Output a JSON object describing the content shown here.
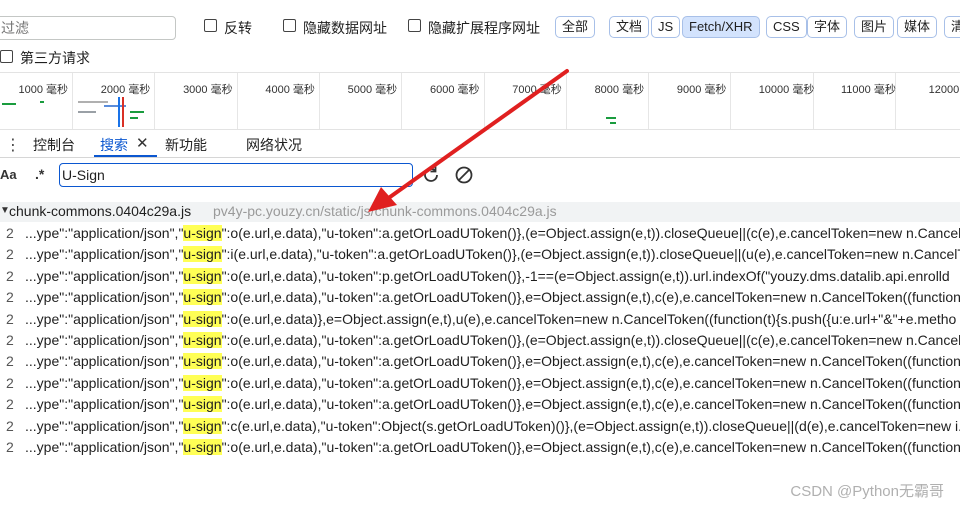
{
  "filter": {
    "placeholder": "过滤",
    "invert_label": "反转",
    "hide_data_urls_label": "隐藏数据网址",
    "hide_extension_urls_label": "隐藏扩展程序网址",
    "chips": [
      "全部",
      "文档",
      "JS",
      "Fetch/XHR",
      "CSS",
      "字体",
      "图片",
      "媒体",
      "清"
    ],
    "active_chip": "Fetch/XHR",
    "third_party_label": "第三方请求"
  },
  "timeline": {
    "ticks": [
      "1000 毫秒",
      "2000 毫秒",
      "3000 毫秒",
      "4000 毫秒",
      "5000 毫秒",
      "6000 毫秒",
      "7000 毫秒",
      "8000 毫秒",
      "9000 毫秒",
      "10000 毫秒",
      "11000 毫秒",
      "12000 毫"
    ]
  },
  "drawer": {
    "tabs": [
      "控制台",
      "搜索",
      "新功能",
      "网络状况"
    ],
    "active_tab": "搜索"
  },
  "search": {
    "case_label": "Aa",
    "regex_label": ".*",
    "query": "U-Sign"
  },
  "results": {
    "file_name": "chunk-commons.0404c29a.js",
    "file_path": "pv4y-pc.youzy.cn/static/js/chunk-commons.0404c29a.js",
    "rows": [
      {
        "line": "2",
        "pre": "...ype\":\"application/json\",\"",
        "match": "u-sign",
        "post": "\":o(e.url,e.data),\"u-token\":a.getOrLoadUToken()},(e=Object.assign(e,t)).closeQueue||(c(e),e.cancelToken=new n.CancelT"
      },
      {
        "line": "2",
        "pre": "...ype\":\"application/json\",\"",
        "match": "u-sign",
        "post": "\":i(e.url,e.data),\"u-token\":a.getOrLoadUToken()},(e=Object.assign(e,t)).closeQueue||(u(e),e.cancelToken=new n.CancelT"
      },
      {
        "line": "2",
        "pre": "...ype\":\"application/json\",\"",
        "match": "u-sign",
        "post": "\":o(e.url,e.data),\"u-token\":p.getOrLoadUToken()},-1==(e=Object.assign(e,t)).url.indexOf(\"youzy.dms.datalib.api.enrolld"
      },
      {
        "line": "2",
        "pre": "...ype\":\"application/json\",\"",
        "match": "u-sign",
        "post": "\":o(e.url,e.data),\"u-token\":a.getOrLoadUToken()},e=Object.assign(e,t),c(e),e.cancelToken=new n.CancelToken((function"
      },
      {
        "line": "2",
        "pre": "...ype\":\"application/json\",\"",
        "match": "u-sign",
        "post": "\":o(e.url,e.data)},e=Object.assign(e,t),u(e),e.cancelToken=new n.CancelToken((function(t){s.push({u:e.url+\"&\"+e.metho"
      },
      {
        "line": "2",
        "pre": "...ype\":\"application/json\",\"",
        "match": "u-sign",
        "post": "\":o(e.url,e.data),\"u-token\":a.getOrLoadUToken()},(e=Object.assign(e,t)).closeQueue||(c(e),e.cancelToken=new n.CancelT"
      },
      {
        "line": "2",
        "pre": "...ype\":\"application/json\",\"",
        "match": "u-sign",
        "post": "\":o(e.url,e.data),\"u-token\":a.getOrLoadUToken()},e=Object.assign(e,t),c(e),e.cancelToken=new n.CancelToken((function"
      },
      {
        "line": "2",
        "pre": "...ype\":\"application/json\",\"",
        "match": "u-sign",
        "post": "\":o(e.url,e.data),\"u-token\":a.getOrLoadUToken()},e=Object.assign(e,t),c(e),e.cancelToken=new n.CancelToken((function"
      },
      {
        "line": "2",
        "pre": "...ype\":\"application/json\",\"",
        "match": "u-sign",
        "post": "\":o(e.url,e.data),\"u-token\":a.getOrLoadUToken()},e=Object.assign(e,t),c(e),e.cancelToken=new n.CancelToken((function"
      },
      {
        "line": "2",
        "pre": "...ype\":\"application/json\",\"",
        "match": "u-sign",
        "post": "\":c(e.url,e.data),\"u-token\":Object(s.getOrLoadUToken)()},(e=Object.assign(e,t)).closeQueue||(d(e),e.cancelToken=new i."
      },
      {
        "line": "2",
        "pre": "...ype\":\"application/json\",\"",
        "match": "u-sign",
        "post": "\":o(e.url,e.data),\"u-token\":a.getOrLoadUToken()},e=Object.assign(e,t),c(e),e.cancelToken=new n.CancelToken((function"
      }
    ]
  },
  "watermark": "CSDN @Python无霸哥",
  "colors": {
    "accent": "#0b57d0",
    "highlight": "#ffff55",
    "arrow": "#e02020",
    "chip_active_bg": "#d3e3fd"
  },
  "icons": {
    "refresh": "refresh-icon",
    "clear": "clear-icon",
    "close_tab": "close-icon",
    "more": "more-vertical-icon"
  }
}
